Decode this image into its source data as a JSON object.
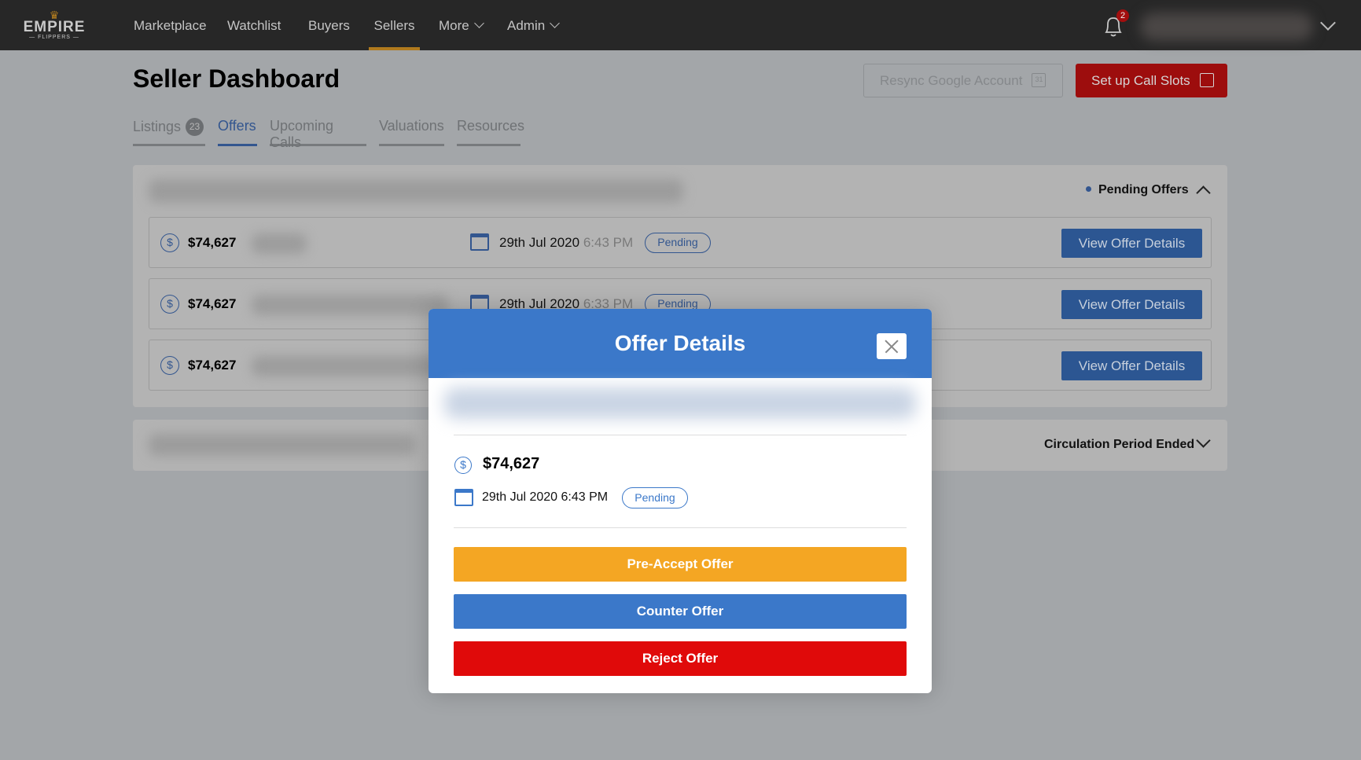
{
  "nav": {
    "logo": {
      "word": "EMPIRE",
      "sub": "— FLIPPERS —"
    },
    "items": [
      {
        "label": "Marketplace"
      },
      {
        "label": "Watchlist"
      },
      {
        "label": "Buyers"
      },
      {
        "label": "Sellers",
        "active": true
      },
      {
        "label": "More"
      },
      {
        "label": "Admin"
      }
    ],
    "notifications_count": "2"
  },
  "page": {
    "title": "Seller Dashboard",
    "resync_label": "Resync Google Account",
    "resync_icon_text": "31",
    "slots_label": "Set up Call Slots"
  },
  "tabs": [
    {
      "label": "Listings",
      "badge": "23"
    },
    {
      "label": "Offers",
      "active": true
    },
    {
      "label": "Upcoming Calls"
    },
    {
      "label": "Valuations"
    },
    {
      "label": "Resources"
    }
  ],
  "pending_panel": {
    "label": "Pending Offers",
    "offers": [
      {
        "amount": "$74,627",
        "date": "29th Jul 2020",
        "time": "6:43 PM",
        "status": "Pending",
        "action": "View Offer Details"
      },
      {
        "amount": "$74,627",
        "date": "29th Jul 2020",
        "time": "6:33 PM",
        "status": "Pending",
        "action": "View Offer Details"
      },
      {
        "amount": "$74,627",
        "date": "",
        "time": "",
        "status": "",
        "action": "View Offer Details"
      }
    ]
  },
  "closed_panel": {
    "label": "Circulation Period Ended"
  },
  "modal": {
    "title": "Offer Details",
    "amount": "$74,627",
    "datetime": "29th Jul 2020 6:43 PM",
    "status": "Pending",
    "buttons": {
      "pre_accept": "Pre-Accept Offer",
      "counter": "Counter Offer",
      "reject": "Reject Offer"
    }
  },
  "colors": {
    "accent": "#3b78c9",
    "pre_accept": "#f4a623",
    "reject": "#e00a0a",
    "brand_red": "#9d0d0d"
  }
}
